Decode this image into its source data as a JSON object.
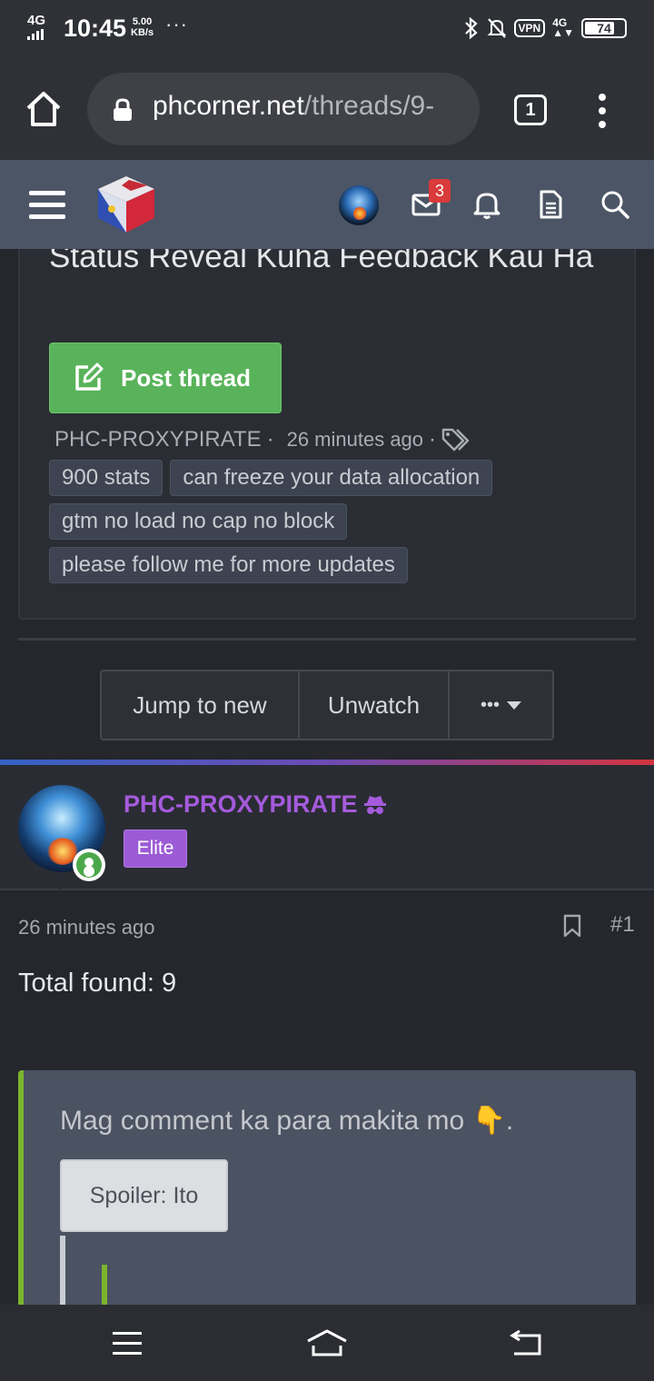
{
  "status_bar": {
    "network": "4G",
    "time": "10:45",
    "speed_value": "5.00",
    "speed_unit": "KB/s",
    "more": "···",
    "vpn": "VPN",
    "net2": "4G",
    "battery": "74",
    "icons": [
      "bluetooth-icon",
      "mute-icon",
      "vpn-icon",
      "signal-4g-icon",
      "battery-icon"
    ]
  },
  "browser": {
    "domain": "phcorner.net",
    "path": "/threads/9-",
    "tab_count": "1",
    "icons": [
      "home-icon",
      "lock-icon",
      "tabs-icon",
      "overflow-menu-icon"
    ]
  },
  "site_header": {
    "mail_badge": "3",
    "icons": [
      "hamburger-icon",
      "phcorner-logo",
      "user-avatar",
      "mail-icon",
      "bell-icon",
      "document-icon",
      "search-icon"
    ]
  },
  "thread": {
    "title": "Status Reveal Kuha Feedback Kau Ha",
    "post_thread_label": "Post thread",
    "author": "PHC-PROXYPIRATE",
    "sep": "·",
    "time": "26 minutes ago",
    "tags": [
      "900 stats",
      "can freeze your data allocation",
      "gtm no load no cap no block",
      "please follow me for more updates"
    ]
  },
  "actions": {
    "jump_to_new": "Jump to new",
    "unwatch": "Unwatch",
    "more": "•••"
  },
  "post": {
    "username": "PHC-PROXYPIRATE",
    "badge": "Elite",
    "time": "26 minutes ago",
    "number": "#1",
    "body": "Total found: 9",
    "quote_text": "Mag comment ka para makita mo 👇.",
    "spoiler_label": "Spoiler: Ito"
  },
  "colors": {
    "accent_green": "#59b35a",
    "username_purple": "#a55bdc",
    "elite_badge": "#9b5bd6",
    "header_bg": "#4b5565",
    "badge_red": "#d93a3a"
  }
}
